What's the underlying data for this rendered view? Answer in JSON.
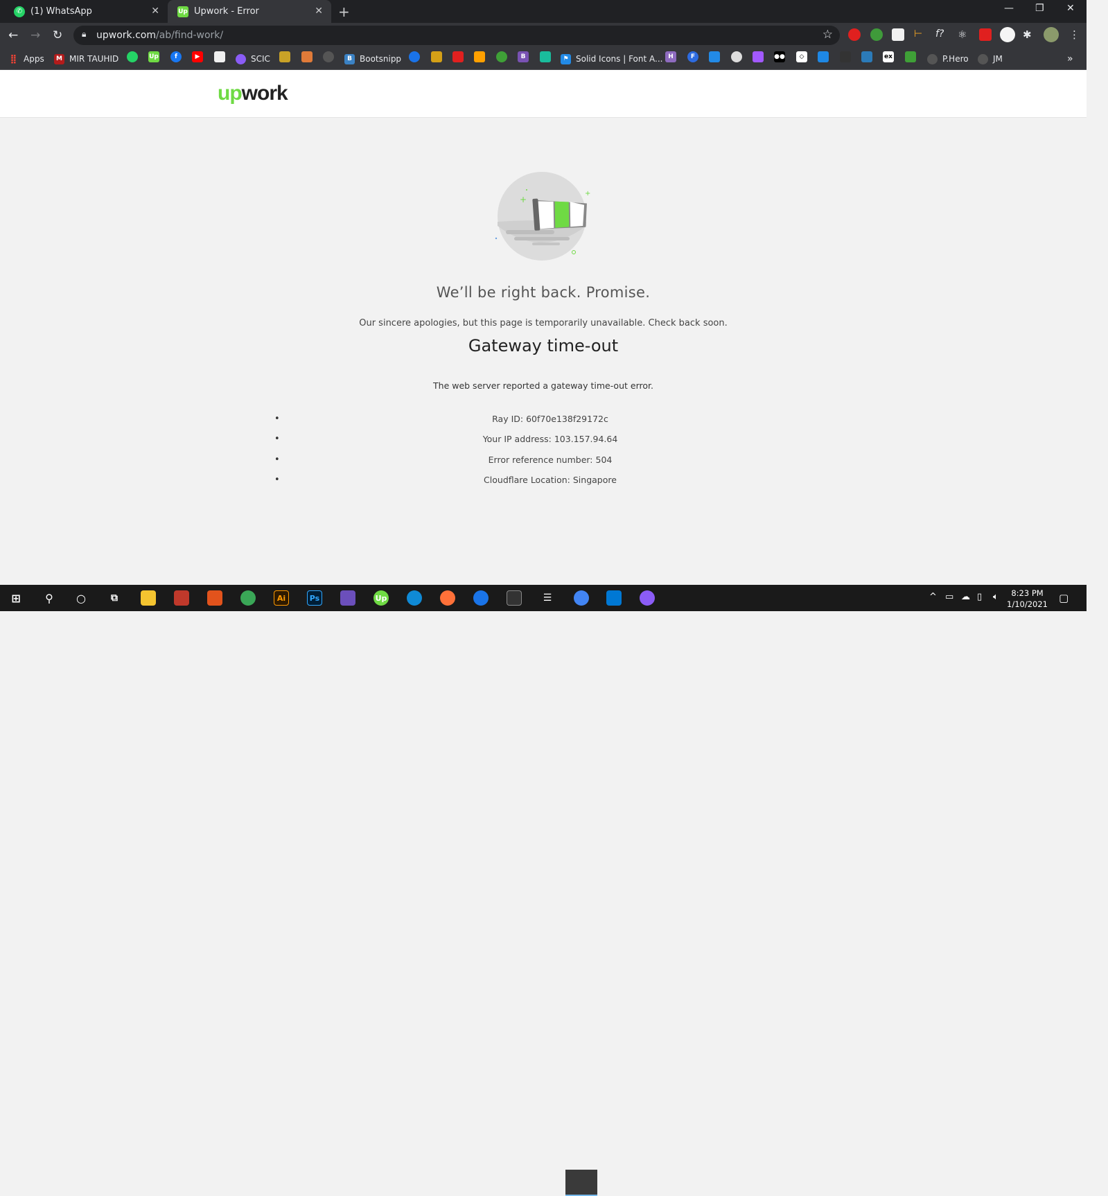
{
  "browser": {
    "tabs": [
      {
        "title": "(1) WhatsApp",
        "active": false
      },
      {
        "title": "Upwork - Error",
        "active": true
      }
    ],
    "url_host": "upwork.com",
    "url_path": "/ab/find-work/",
    "bookmarks": [
      {
        "label": "Apps",
        "icon": "apps-grid-icon"
      },
      {
        "label": "MIR TAUHID",
        "icon": "mir-tauhid-icon"
      },
      {
        "label": "SCIC",
        "icon": "scic-icon"
      },
      {
        "label": "Bootsnipp",
        "icon": "bootsnipp-icon"
      },
      {
        "label": "Solid Icons | Font A...",
        "icon": "font-awesome-icon"
      },
      {
        "label": "P.Hero",
        "icon": "github-icon"
      },
      {
        "label": "JM",
        "icon": "github-icon"
      }
    ],
    "overflow_chevron": "»"
  },
  "site": {
    "logo_up": "up",
    "logo_work": "work"
  },
  "error": {
    "headline": "We’ll be right back. Promise.",
    "apology": "Our sincere apologies, but this page is temporarily unavailable. Check back soon.",
    "title": "Gateway time-out",
    "reported": "The web server reported a gateway time-out error.",
    "details": [
      "Ray ID: 60f70e138f29172c",
      "Your IP address: 103.157.94.64",
      "Error reference number: 504",
      "Cloudflare Location: Singapore"
    ]
  },
  "taskbar": {
    "time": "8:23 PM",
    "date": "1/10/2021"
  },
  "colors": {
    "brand_green": "#6fda44",
    "chrome_dark": "#202124",
    "chrome_toolbar": "#35363a",
    "page_bg": "#f2f2f2"
  }
}
